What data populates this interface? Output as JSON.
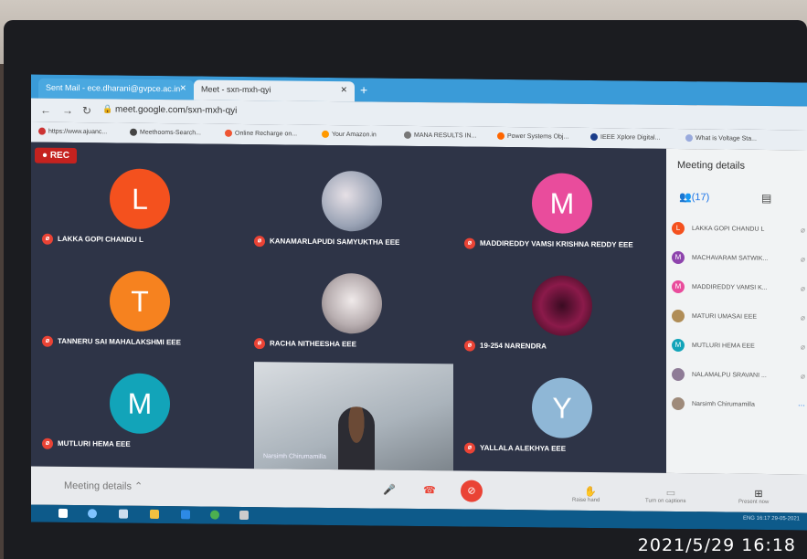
{
  "browser": {
    "tabs": [
      {
        "label": "Sent Mail - ece.dharani@gvpce.ac.in"
      },
      {
        "label": "Meet - sxn-mxh-qyi"
      }
    ],
    "url": "meet.google.com/sxn-mxh-qyi",
    "bookmarks": [
      "https://www.ajuanc...",
      "Meethooms-Search...",
      "Online Recharge on...",
      "Your Amazon.in",
      "MANA RESULTS IN...",
      "Power Systems Obj...",
      "IEEE Xplore Digital...",
      "What is Voltage Sta..."
    ]
  },
  "meet": {
    "rec_label": "REC",
    "tiles": [
      {
        "initial": "L",
        "name": "LAKKA GOPI CHANDU L",
        "color": "#f4511e"
      },
      {
        "initial": "",
        "name": "KANAMARLAPUDI SAMYUKTHA EEE",
        "color": "#8e99b5"
      },
      {
        "initial": "M",
        "name": "MADDIREDDY VAMSI KRISHNA REDDY EEE",
        "color": "#e94c9c"
      },
      {
        "initial": "T",
        "name": "TANNERU SAI MAHALAKSHMI EEE",
        "color": "#f6821f"
      },
      {
        "initial": "",
        "name": "RACHA NITHEESHA EEE",
        "color": "#b3a9ab"
      },
      {
        "initial": "",
        "name": "19-254 NARENDRA",
        "color": "#8b1a4a"
      },
      {
        "initial": "M",
        "name": "MUTLURI HEMA EEE",
        "color": "#12a4b9"
      },
      {
        "initial": "Y",
        "name": "YALLALA ALEKHYA EEE",
        "color": "#8fb7d6"
      }
    ],
    "video_name": "Narsimh Chirumamilla",
    "panel": {
      "title": "Meeting details",
      "count": "(17)",
      "participants": [
        {
          "initial": "L",
          "name": "LAKKA GOPI CHANDU L",
          "color": "#f4511e"
        },
        {
          "initial": "M",
          "name": "MACHAVARAM SATWIK...",
          "color": "#8e44ad"
        },
        {
          "initial": "M",
          "name": "MADDIREDDY VAMSI K...",
          "color": "#e94c9c"
        },
        {
          "initial": "",
          "name": "MATURI UMASAI EEE",
          "color": "#b08d57"
        },
        {
          "initial": "M",
          "name": "MUTLURI HEMA EEE",
          "color": "#12a4b9"
        },
        {
          "initial": "",
          "name": "NALAMALPU SRAVANI ...",
          "color": "#8e7b96"
        },
        {
          "initial": "",
          "name": "Narsimh Chirumamilla",
          "color": "#9e8a7a"
        }
      ]
    },
    "bottom": {
      "details_label": "Meeting details",
      "raise_hand": "Raise hand",
      "captions": "Turn on captions",
      "present": "Present now"
    }
  },
  "taskbar": {
    "tray": "ENG  16:17  29-05-2021"
  },
  "timestamp": "2021/5/29  16:18"
}
